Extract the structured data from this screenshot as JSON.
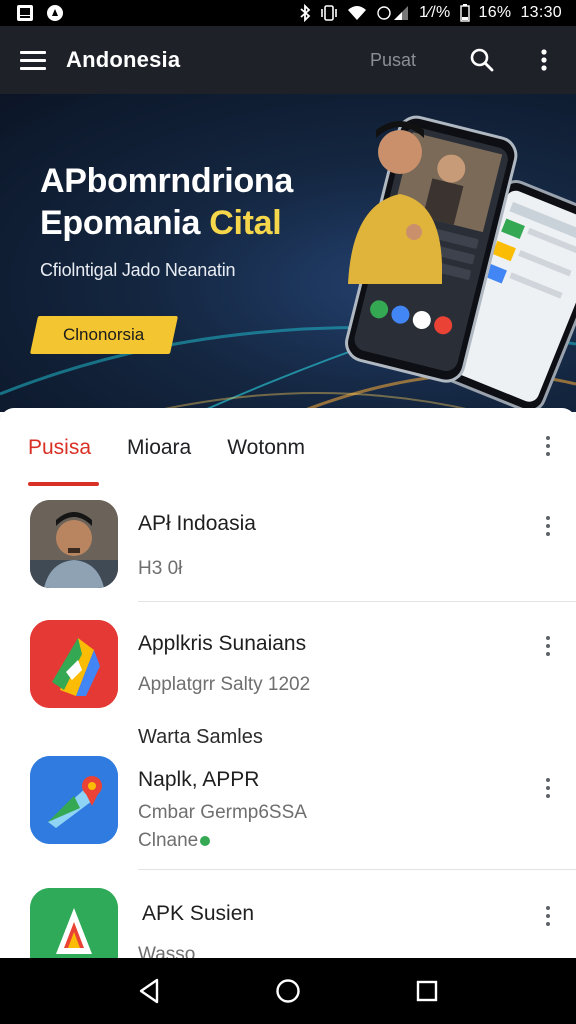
{
  "status_bar": {
    "icons_left": [
      "gallery-icon",
      "notification-badge-icon"
    ],
    "icons_right": [
      "bluetooth-icon",
      "vibrate-icon",
      "wifi-icon",
      "cellular-icon"
    ],
    "signal_text": "1⁄/%",
    "battery_text": "16%",
    "time": "13:30"
  },
  "app_bar": {
    "title": "Andonesia",
    "pusat_label": "Pusat",
    "icons": [
      "menu-icon",
      "search-icon",
      "more-vert-icon"
    ]
  },
  "banner": {
    "title_line1": "APbomrndriona",
    "title_line2_plain": "Epomania ",
    "title_line2_accent": "Cital",
    "subtitle": "Cﬁolntigal Jado Neanatin",
    "cta_label": "Clnonorsia",
    "accent_color": "#f6d64a",
    "cta_color": "#f3c531"
  },
  "tabs": {
    "items": [
      {
        "label": "Pusisa",
        "active": true
      },
      {
        "label": "Mioara",
        "active": false
      },
      {
        "label": "Wotonm",
        "active": false
      }
    ],
    "active_color": "#d93025"
  },
  "list": {
    "items": [
      {
        "title": "APł Indoasia",
        "subtitle": "H3 0ł",
        "icon": "avatar-photo-icon"
      },
      {
        "title": "Applkris Sunaians",
        "subtitle": "Applatgrr Salty 1202",
        "icon": "red-app-icon"
      },
      {
        "section_label": "Warta Samles",
        "title": "Naplk, APPR",
        "subtitle": "Cmbar Germp6SSA",
        "subtitle2": "Clnane",
        "icon": "blue-maps-app-icon"
      },
      {
        "title": "APK Susien",
        "subtitle": "Wasso",
        "icon": "green-app-icon"
      }
    ]
  },
  "nav_bar": {
    "icons": [
      "back-icon",
      "home-icon",
      "recents-icon"
    ]
  }
}
